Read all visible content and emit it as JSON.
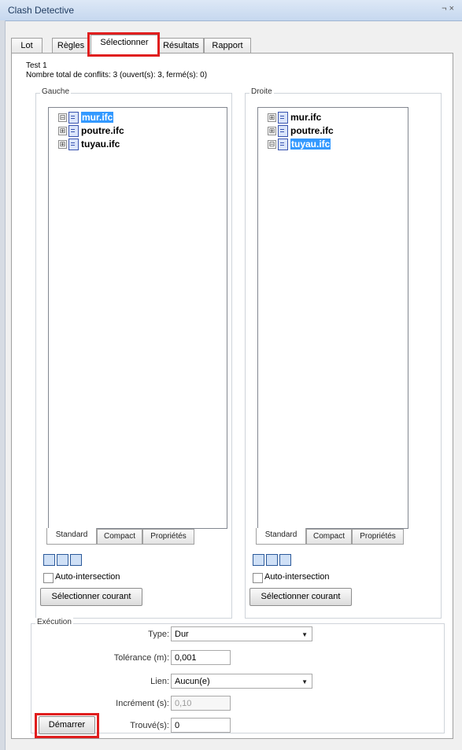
{
  "window": {
    "title": "Clash Detective",
    "controls": "¬ ×"
  },
  "tabs": [
    "Lot",
    "Règles",
    "Sélectionner",
    "Résultats",
    "Rapport"
  ],
  "test": {
    "name": "Test 1",
    "summary": "Nombre total de conflits: 3 (ouvert(s): 3, fermé(s): 0)"
  },
  "left": {
    "label": "Gauche",
    "items": [
      {
        "label": "mur.ifc",
        "expander": "⊟",
        "selected": true
      },
      {
        "label": "poutre.ifc",
        "expander": "⊞",
        "selected": false
      },
      {
        "label": "tuyau.ifc",
        "expander": "⊞",
        "selected": false
      }
    ],
    "subtabs": [
      "Standard",
      "Compact",
      "Propriétés"
    ],
    "auto_intersection": "Auto-intersection",
    "select_current": "Sélectionner courant"
  },
  "right": {
    "label": "Droite",
    "items": [
      {
        "label": "mur.ifc",
        "expander": "⊞",
        "selected": false
      },
      {
        "label": "poutre.ifc",
        "expander": "⊞",
        "selected": false
      },
      {
        "label": "tuyau.ifc",
        "expander": "⊟",
        "selected": true
      }
    ],
    "subtabs": [
      "Standard",
      "Compact",
      "Propriétés"
    ],
    "auto_intersection": "Auto-intersection",
    "select_current": "Sélectionner courant"
  },
  "execution": {
    "label": "Exécution",
    "type_label": "Type:",
    "type_value": "Dur",
    "tolerance_label": "Tolérance (m):",
    "tolerance_value": "0,001",
    "link_label": "Lien:",
    "link_value": "Aucun(e)",
    "increment_label": "Incrément (s):",
    "increment_value": "0,10",
    "found_label": "Trouvé(s):",
    "found_value": "0",
    "start_button": "Démarrer"
  },
  "colors": {
    "highlight": "#e01e1e",
    "selection": "#3399ff"
  }
}
